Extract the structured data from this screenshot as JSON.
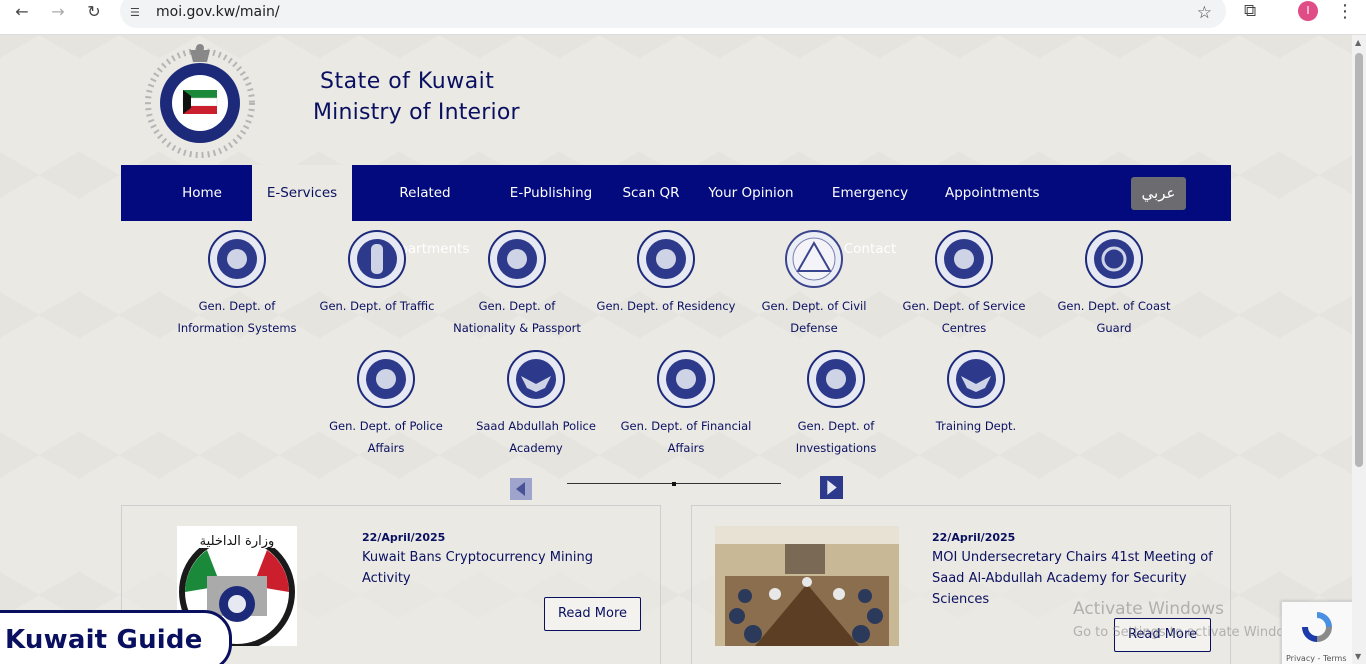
{
  "browser": {
    "url": "moi.gov.kw/main/",
    "profile_initial": "I"
  },
  "header": {
    "title_line1": "State of Kuwait",
    "title_line2": "Ministry of Interior"
  },
  "nav": {
    "items": [
      "Home",
      "E-Services",
      "Related Departments",
      "E-Publishing",
      "Scan QR",
      "Your Opinion",
      "Emergency Contact",
      "Appointments"
    ],
    "active": "E-Services",
    "lang_label": "عربي"
  },
  "departments": {
    "row1": [
      {
        "line1": "Gen. Dept. of",
        "line2": "Information Systems"
      },
      {
        "line1": "Gen. Dept. of Traffic",
        "line2": ""
      },
      {
        "line1": "Gen. Dept. of",
        "line2": "Nationality & Passport"
      },
      {
        "line1": "Gen. Dept. of Residency",
        "line2": ""
      },
      {
        "line1": "Gen. Dept. of Civil",
        "line2": "Defense"
      },
      {
        "line1": "Gen. Dept. of Service",
        "line2": "Centres"
      },
      {
        "line1": "Gen. Dept. of Coast",
        "line2": "Guard"
      }
    ],
    "row2": [
      {
        "line1": "Gen. Dept. of Police",
        "line2": "Affairs"
      },
      {
        "line1": "Saad Abdullah Police",
        "line2": "Academy"
      },
      {
        "line1": "Gen. Dept. of Financial",
        "line2": "Affairs"
      },
      {
        "line1": "Gen. Dept. of",
        "line2": "Investigations"
      },
      {
        "line1": "Training Dept.",
        "line2": ""
      }
    ]
  },
  "news": [
    {
      "date": "22/April/2025",
      "title_line1": "Kuwait Bans Cryptocurrency Mining",
      "title_line2": "Activity",
      "title_line3": "",
      "button": "Read More"
    },
    {
      "date": "22/April/2025",
      "title_line1": "MOI Undersecretary Chairs 41st Meeting of",
      "title_line2": "Saad Al-Abdullah Academy for Security",
      "title_line3": "Sciences",
      "button": "Read More"
    }
  ],
  "overlays": {
    "watermark_line1": "Activate Windows",
    "watermark_line2": "Go to Settings to activate Windows.",
    "recaptcha_links": "Privacy - Terms",
    "guide_badge": "Kuwait Guide"
  },
  "colors": {
    "navy": "#020a7e",
    "text_navy": "#0a1060",
    "page_bg": "#ebe9e4"
  }
}
